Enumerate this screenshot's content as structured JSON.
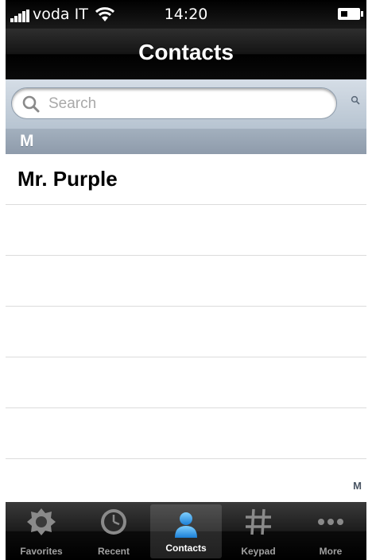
{
  "status_bar": {
    "carrier": "voda IT",
    "time": "14:20"
  },
  "nav": {
    "title": "Contacts"
  },
  "search": {
    "placeholder": "Search"
  },
  "section": {
    "letter": "M"
  },
  "contacts": [
    {
      "name": "Mr. Purple"
    }
  ],
  "index": {
    "letter": "M"
  },
  "tabs": [
    {
      "label": "Favorites",
      "icon": "gear-icon",
      "selected": false
    },
    {
      "label": "Recent",
      "icon": "clock-icon",
      "selected": false
    },
    {
      "label": "Contacts",
      "icon": "person-icon",
      "selected": true
    },
    {
      "label": "Keypad",
      "icon": "keypad-icon",
      "selected": false
    },
    {
      "label": "More",
      "icon": "more-icon",
      "selected": false
    }
  ],
  "colors": {
    "accent": "#2aa3f0",
    "nav": "#0a0a0a",
    "section_header": "#98a5b4"
  }
}
